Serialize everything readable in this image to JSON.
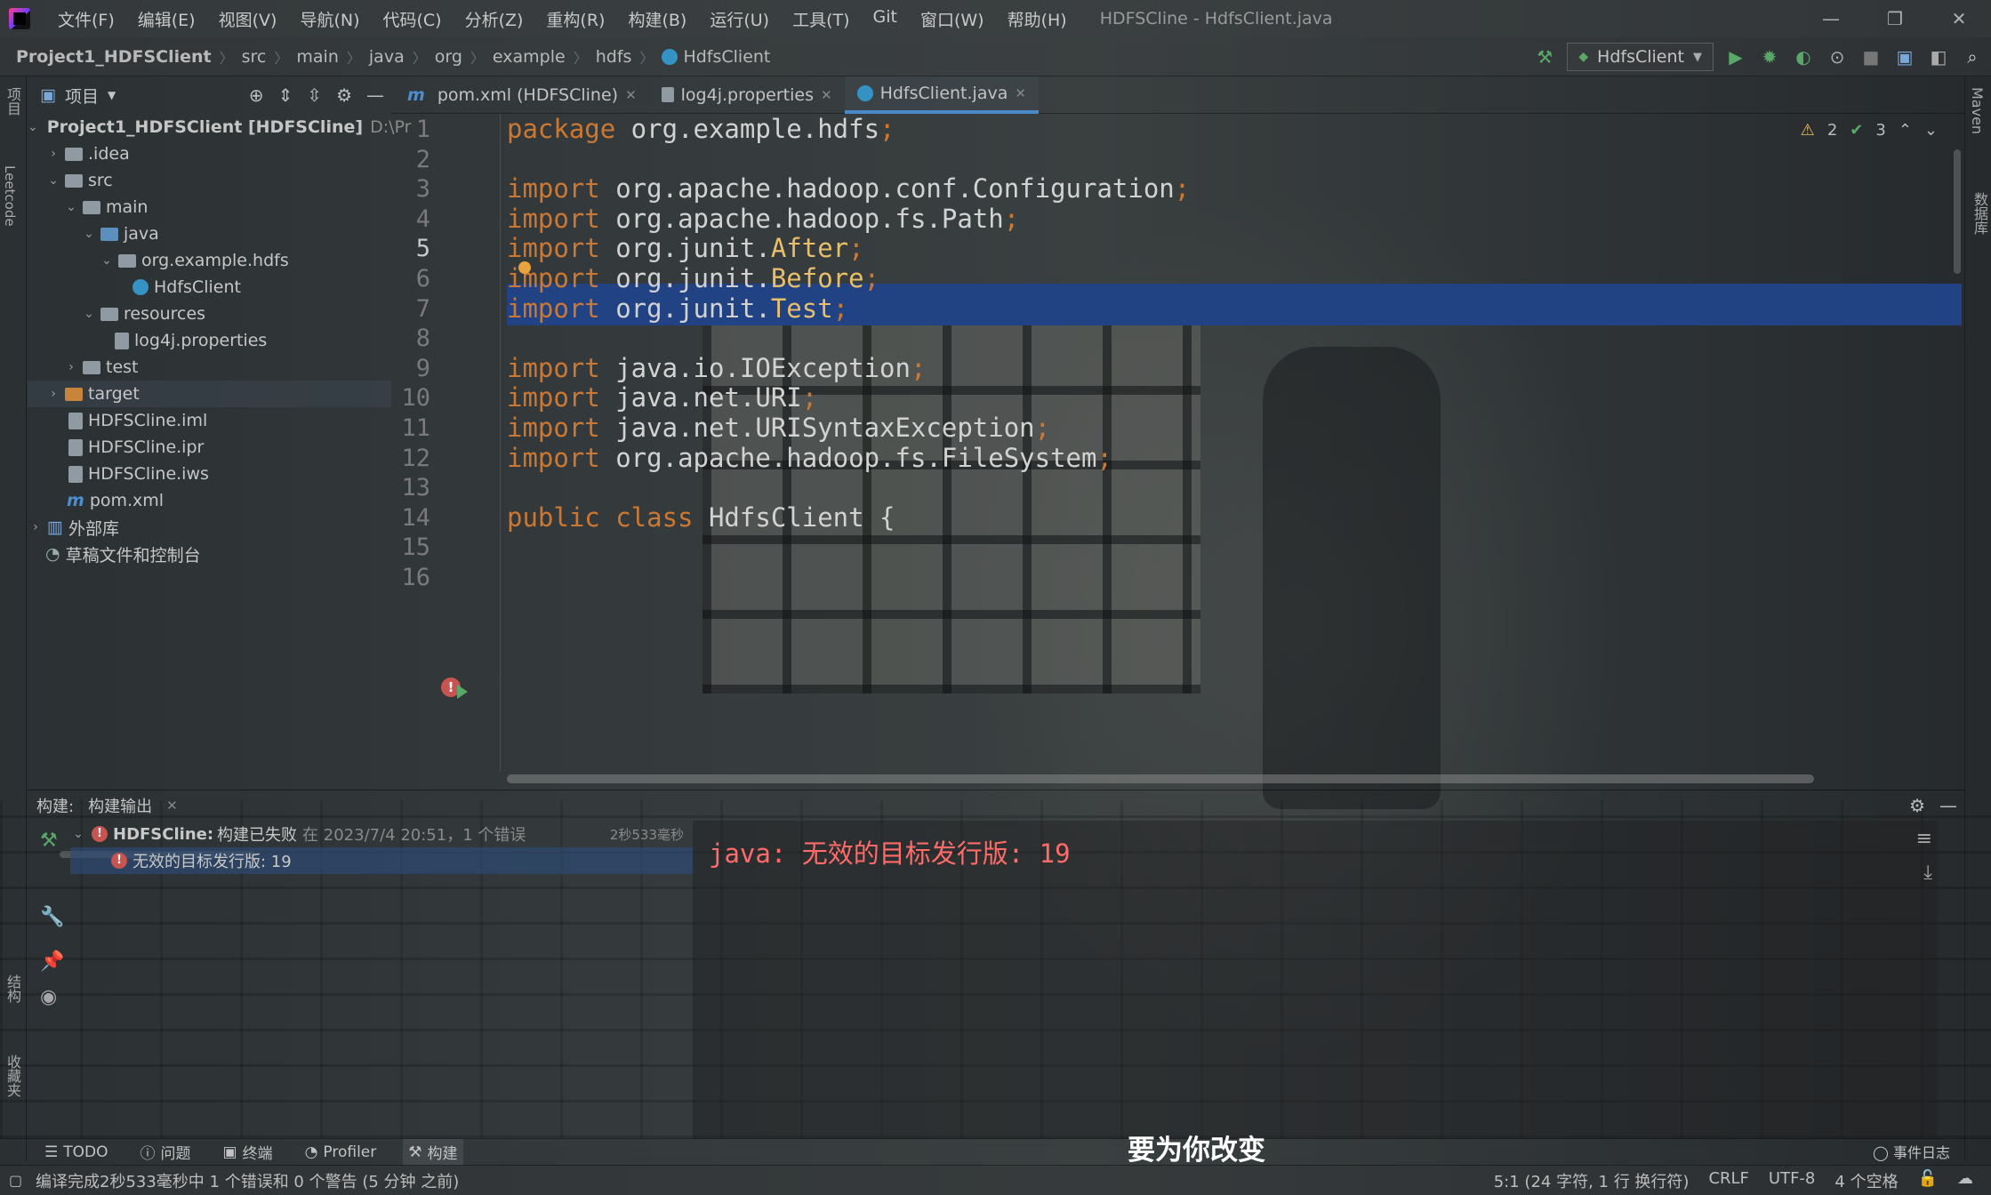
{
  "window": {
    "title": "HDFSCline - HdfsClient.java",
    "menu": [
      "文件(F)",
      "编辑(E)",
      "视图(V)",
      "导航(N)",
      "代码(C)",
      "分析(Z)",
      "重构(R)",
      "构建(B)",
      "运行(U)",
      "工具(T)",
      "Git",
      "窗口(W)",
      "帮助(H)"
    ]
  },
  "breadcrumb": [
    "Project1_HDFSClient",
    "src",
    "main",
    "java",
    "org",
    "example",
    "hdfs",
    "HdfsClient"
  ],
  "run_config": "HdfsClient",
  "left_stripe": [
    "项目",
    "Leetcode",
    "结构",
    "收藏夹"
  ],
  "right_stripe": [
    "Maven",
    "数据库"
  ],
  "project": {
    "header": "项目",
    "root": "Project1_HDFSClient [HDFSCline]",
    "root_path": "D:\\Pr",
    "items": [
      ".idea",
      "src",
      "main",
      "java",
      "org.example.hdfs",
      "HdfsClient",
      "resources",
      "log4j.properties",
      "test",
      "target",
      "HDFSCline.iml",
      "HDFSCline.ipr",
      "HDFSCline.iws",
      "pom.xml",
      "外部库",
      "草稿文件和控制台"
    ]
  },
  "tabs": [
    {
      "label": "pom.xml (HDFSCline)",
      "icon": "maven-icon"
    },
    {
      "label": "log4j.properties",
      "icon": "properties-icon"
    },
    {
      "label": "HdfsClient.java",
      "icon": "class-icon",
      "active": true
    }
  ],
  "inspections": {
    "warnings": "2",
    "ok": "3"
  },
  "code": {
    "current_line": 5,
    "lines": [
      [
        [
          "kw",
          "package"
        ],
        [
          "pk",
          " org.example.hdfs"
        ],
        [
          "semi",
          ";"
        ]
      ],
      [],
      [
        [
          "kw",
          "import"
        ],
        [
          "pk",
          " org.apache.hadoop.conf.Configuration"
        ],
        [
          "semi",
          ";"
        ]
      ],
      [
        [
          "kw",
          "import"
        ],
        [
          "pk",
          " org.apache.hadoop.fs.Path"
        ],
        [
          "semi",
          ";"
        ]
      ],
      [
        [
          "kw",
          "import"
        ],
        [
          "pk",
          " org.junit."
        ],
        [
          "ann",
          "After"
        ],
        [
          "semi",
          ";"
        ]
      ],
      [
        [
          "kw",
          "import"
        ],
        [
          "pk",
          " org.junit."
        ],
        [
          "ann",
          "Before"
        ],
        [
          "semi",
          ";"
        ]
      ],
      [
        [
          "kw",
          "import"
        ],
        [
          "pk",
          " org.junit."
        ],
        [
          "ann",
          "Test"
        ],
        [
          "semi",
          ";"
        ]
      ],
      [],
      [
        [
          "kw",
          "import"
        ],
        [
          "pk",
          " java.io.IOException"
        ],
        [
          "semi",
          ";"
        ]
      ],
      [
        [
          "kw",
          "import"
        ],
        [
          "pk",
          " java.net.URI"
        ],
        [
          "semi",
          ";"
        ]
      ],
      [
        [
          "kw",
          "import"
        ],
        [
          "pk",
          " java.net.URISyntaxException"
        ],
        [
          "semi",
          ";"
        ]
      ],
      [
        [
          "kw",
          "import"
        ],
        [
          "pk",
          " org.apache.hadoop.fs.FileSystem"
        ],
        [
          "semi",
          ";"
        ]
      ],
      [],
      [
        [
          "kw",
          "public class"
        ],
        [
          "pk",
          " HdfsClient {"
        ]
      ],
      [],
      []
    ]
  },
  "build": {
    "tab_prefix": "构建:",
    "tab": "构建输出",
    "summary_name": "HDFSCline:",
    "summary": "构建已失败",
    "summary_detail": "在 2023/7/4 20:51，1 个错误",
    "duration": "2秒533毫秒",
    "error_item": "无效的目标发行版: 19",
    "output": "java: 无效的目标发行版: 19"
  },
  "toolstrip": [
    {
      "label": "TODO"
    },
    {
      "label": "问题"
    },
    {
      "label": "终端"
    },
    {
      "label": "Profiler"
    },
    {
      "label": "构建",
      "active": true
    }
  ],
  "event_log": "事件日志",
  "subtitle": "要为你改变",
  "status": {
    "message": "编译完成2秒533毫秒中 1 个错误和 0 个警告 (5 分钟 之前)",
    "position": "5:1 (24 字符, 1 行 换行符)",
    "line_sep": "CRLF",
    "encoding": "UTF-8",
    "indent": "4 个空格"
  }
}
